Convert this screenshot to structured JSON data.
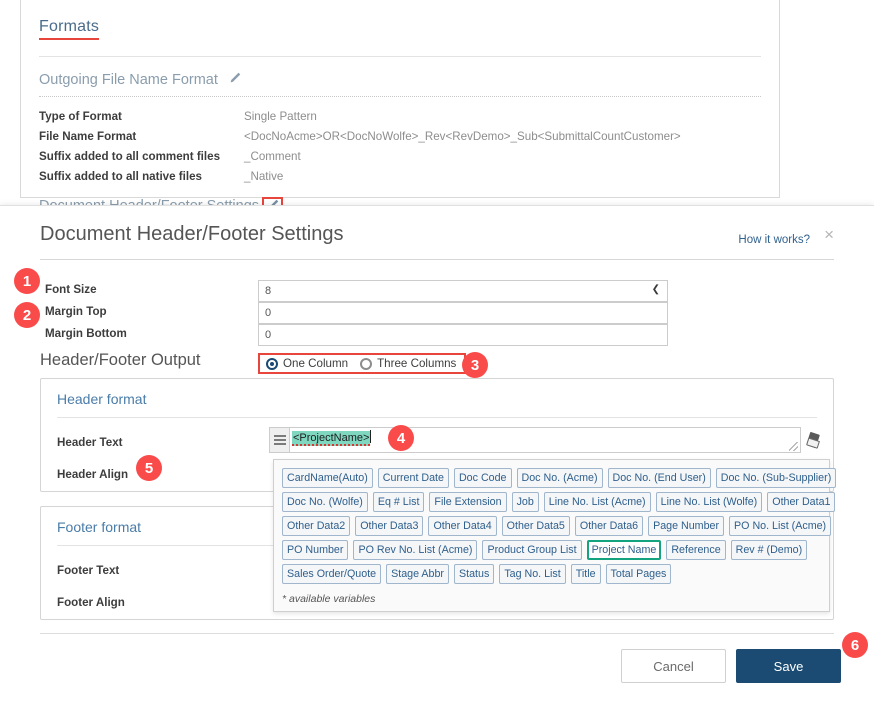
{
  "background": {
    "title": "Formats",
    "section_label": "Outgoing File Name Format",
    "edit_icon": "pencil-icon",
    "rows": [
      {
        "label": "Type of Format",
        "value": "Single Pattern"
      },
      {
        "label": "File Name Format",
        "value": "<DocNoAcme>OR<DocNoWolfe>_Rev<RevDemo>_Sub<SubmittalCountCustomer>"
      },
      {
        "label": "Suffix added to all comment files",
        "value": "_Comment"
      },
      {
        "label": "Suffix added to all native files",
        "value": "_Native"
      }
    ],
    "section_label_2": "Document Header/Footer Settings"
  },
  "modal": {
    "title": "Document Header/Footer Settings",
    "help_link": "How it works?",
    "close_label": "×",
    "fields": [
      {
        "label": "Font Size",
        "value": "8",
        "type": "select"
      },
      {
        "label": "Margin Top",
        "value": "0",
        "type": "text"
      },
      {
        "label": "Margin Bottom",
        "value": "0",
        "type": "text"
      }
    ],
    "output_section": {
      "heading": "Header/Footer Output",
      "options": [
        {
          "label": "One Column",
          "selected": true
        },
        {
          "label": "Three Columns",
          "selected": false
        }
      ]
    },
    "header_card": {
      "title": "Header format",
      "text_label": "Header Text",
      "text_value": "<ProjectName>",
      "align_label": "Header Align"
    },
    "footer_card": {
      "title": "Footer format",
      "text_label": "Footer Text",
      "align_label": "Footer Align"
    },
    "variables_panel": {
      "rows": [
        [
          "CardName(Auto)",
          "Current Date",
          "Doc Code",
          "Doc No. (Acme)",
          "Doc No. (End User)",
          "Doc No. (Sub-Supplier)"
        ],
        [
          "Doc No. (Wolfe)",
          "Eq # List",
          "File Extension",
          "Job",
          "Line No. List (Acme)",
          "Line No. List (Wolfe)",
          "Other Data1"
        ],
        [
          "Other Data2",
          "Other Data3",
          "Other Data4",
          "Other Data5",
          "Other Data6",
          "Page Number",
          "PO No. List (Acme)"
        ],
        [
          "PO Number",
          "PO Rev No. List (Acme)",
          "Product Group List",
          "Project Name",
          "Reference",
          "Rev # (Demo)"
        ],
        [
          "Sales Order/Quote",
          "Stage Abbr",
          "Status",
          "Tag No. List",
          "Title",
          "Total Pages"
        ]
      ],
      "selected": "Project Name",
      "note": "* available variables"
    },
    "buttons": {
      "cancel": "Cancel",
      "save": "Save"
    }
  },
  "annotations": {
    "badges": [
      "1",
      "2",
      "3",
      "4",
      "5",
      "6"
    ],
    "badge_color": "#fa4b4b",
    "highlight_color": "#e8453c",
    "selected_tag_color": "#13a37f",
    "token_highlight_color": "#7fd7c0"
  }
}
